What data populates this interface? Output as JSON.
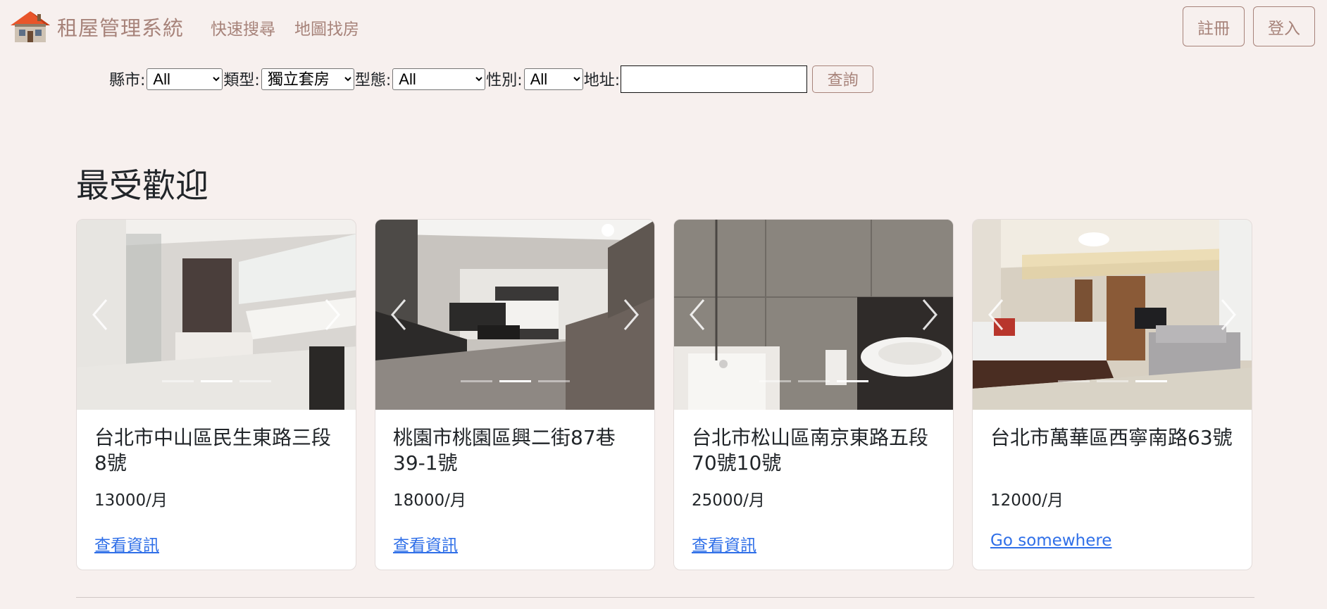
{
  "brand": {
    "logo_icon": "house-icon",
    "name": "租屋管理系統"
  },
  "nav": {
    "links": [
      "快速搜尋",
      "地圖找房"
    ]
  },
  "auth": {
    "register": "註冊",
    "login": "登入"
  },
  "search": {
    "county_label": "縣市:",
    "county_value": "All",
    "type_label": "類型:",
    "type_value": "獨立套房",
    "form_label": "型態:",
    "form_value": "All",
    "gender_label": "性別:",
    "gender_value": "All",
    "address_label": "地址:",
    "address_value": "",
    "submit": "查詢"
  },
  "section": {
    "title": "最受歡迎"
  },
  "colors": {
    "accent": "#a7837a",
    "background": "#f7f0ee",
    "link": "#2f6fe8"
  },
  "cards": [
    {
      "title": "台北市中山區民生東路三段8號",
      "price": "13000/月",
      "link": "查看資訊",
      "active_slide": 1
    },
    {
      "title": "桃園市桃園區興二街87巷39-1號",
      "price": "18000/月",
      "link": "查看資訊",
      "active_slide": 1
    },
    {
      "title": "台北市松山區南京東路五段70號10號",
      "price": "25000/月",
      "link": "查看資訊",
      "active_slide": 2
    },
    {
      "title": "台北市萬華區西寧南路63號",
      "price": "12000/月",
      "link": "Go somewhere",
      "active_slide": 2
    }
  ]
}
